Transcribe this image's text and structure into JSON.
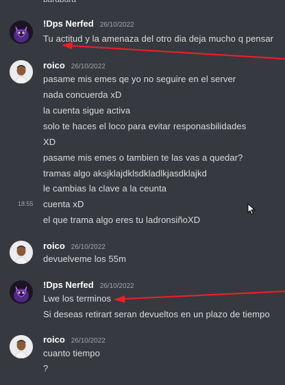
{
  "partial_top_text": "barabara",
  "messages": [
    {
      "user": "!Dps Nerfed",
      "time": "26/10/2022",
      "avatar": "demon-avatar-icon",
      "lines": [
        "Tu actitud y la amenaza del otro dia deja mucho q pensar"
      ]
    },
    {
      "user": "roico",
      "time": "26/10/2022",
      "avatar": "man-avatar-icon",
      "lines": [
        "pasame mis emes qe yo no seguire en el server",
        "nada concuerda xD",
        "la cuenta sigue activa",
        "solo te haces el loco para evitar responasbilidades",
        "XD",
        "pasame mis emes o tambien te las vas a quedar?",
        "tramas algo aksjklajdklsdkladlkjasdklajkd",
        "le cambias la clave a la ceunta",
        "cuenta xD",
        "el que trama algo eres tu ladronsiñoXD"
      ],
      "hover_time": "18:55"
    },
    {
      "user": "roico",
      "time": "26/10/2022",
      "avatar": "man-avatar-icon",
      "lines": [
        "devuelveme los 55m"
      ]
    },
    {
      "user": "!Dps Nerfed",
      "time": "26/10/2022",
      "avatar": "demon-avatar-icon",
      "lines": [
        "Lwe los terminos",
        "Si deseas retirart seran devueltos en un plazo de tiempo"
      ]
    },
    {
      "user": "roico",
      "time": "26/10/2022",
      "avatar": "man-avatar-icon",
      "lines": [
        "cuanto tiempo",
        "?"
      ]
    }
  ],
  "colors": {
    "background": "#36393f",
    "username": "#ffffff",
    "message_text": "#dcddde",
    "timestamp": "#a3a6aa",
    "annotation_arrow": "#e8202a"
  }
}
